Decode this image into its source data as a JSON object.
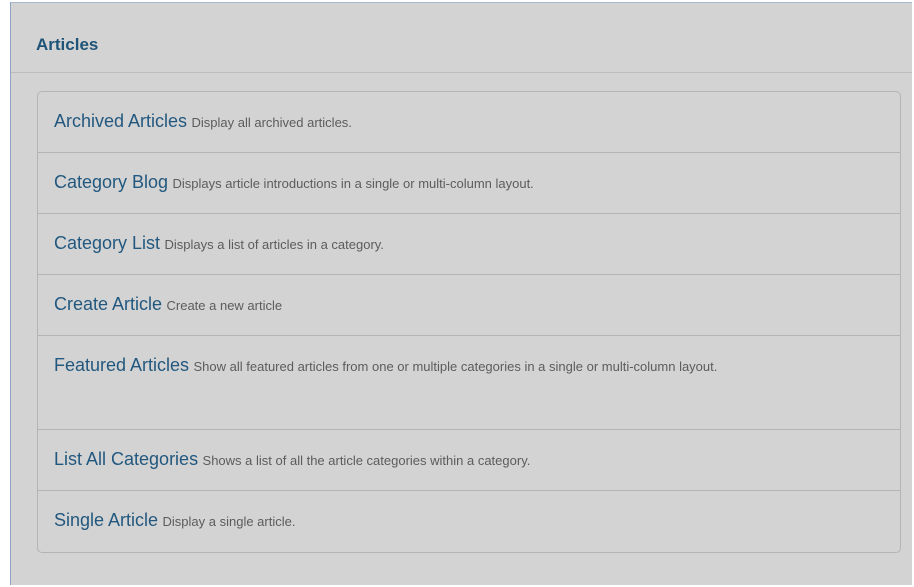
{
  "panel": {
    "title": "Articles"
  },
  "items": [
    {
      "title": "Archived Articles",
      "desc": "Display all archived articles."
    },
    {
      "title": "Category Blog",
      "desc": "Displays article introductions in a single or multi-column layout."
    },
    {
      "title": "Category List",
      "desc": "Displays a list of articles in a category."
    },
    {
      "title": "Create Article",
      "desc": "Create a new article"
    },
    {
      "title": "Featured Articles",
      "desc": "Show all featured articles from one or multiple categories in a single or multi-column layout."
    },
    {
      "title": "List All Categories",
      "desc": "Shows a list of all the article categories within a category."
    },
    {
      "title": "Single Article",
      "desc": "Display a single article."
    }
  ],
  "colors": {
    "panel_background": "#d3d3d3",
    "title_color": "#1f5478",
    "link_color": "#22587f",
    "description_color": "#5c5c5c"
  }
}
